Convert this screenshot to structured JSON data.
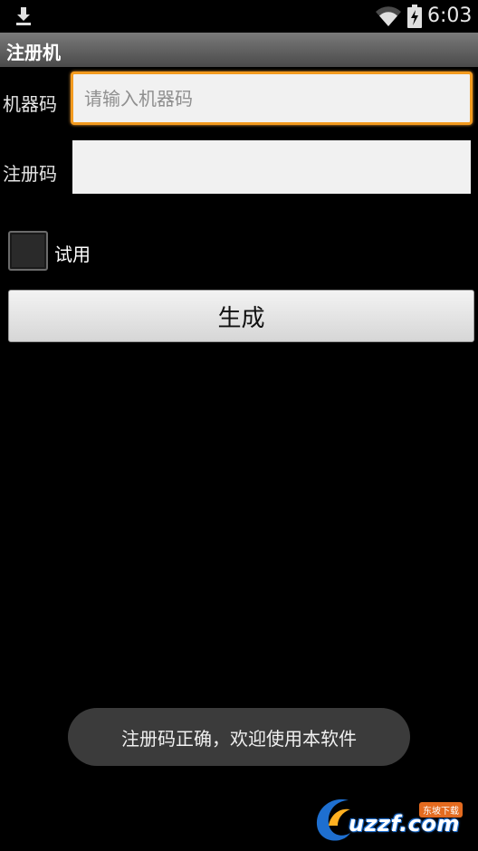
{
  "status_bar": {
    "time": "6:03",
    "icons": [
      "download-icon",
      "wifi-icon",
      "battery-charging-icon"
    ]
  },
  "app": {
    "title": "注册机"
  },
  "form": {
    "machine_code_label": "机器码",
    "machine_code_value": "",
    "machine_code_placeholder": "请输入机器码",
    "reg_code_label": "注册码",
    "reg_code_value": "",
    "trial_label": "试用",
    "trial_checked": false,
    "generate_label": "生成"
  },
  "toast": {
    "message": "注册码正确，欢迎使用本软件"
  },
  "watermark": {
    "text": "uzzf.com",
    "badge": "东坡下载"
  },
  "colors": {
    "focus_border": "#f39b1f",
    "background": "#000000",
    "titlebar": "#5c5c5c",
    "toast_bg": "#3b3b3b",
    "watermark_blue": "#1e6fd0"
  }
}
